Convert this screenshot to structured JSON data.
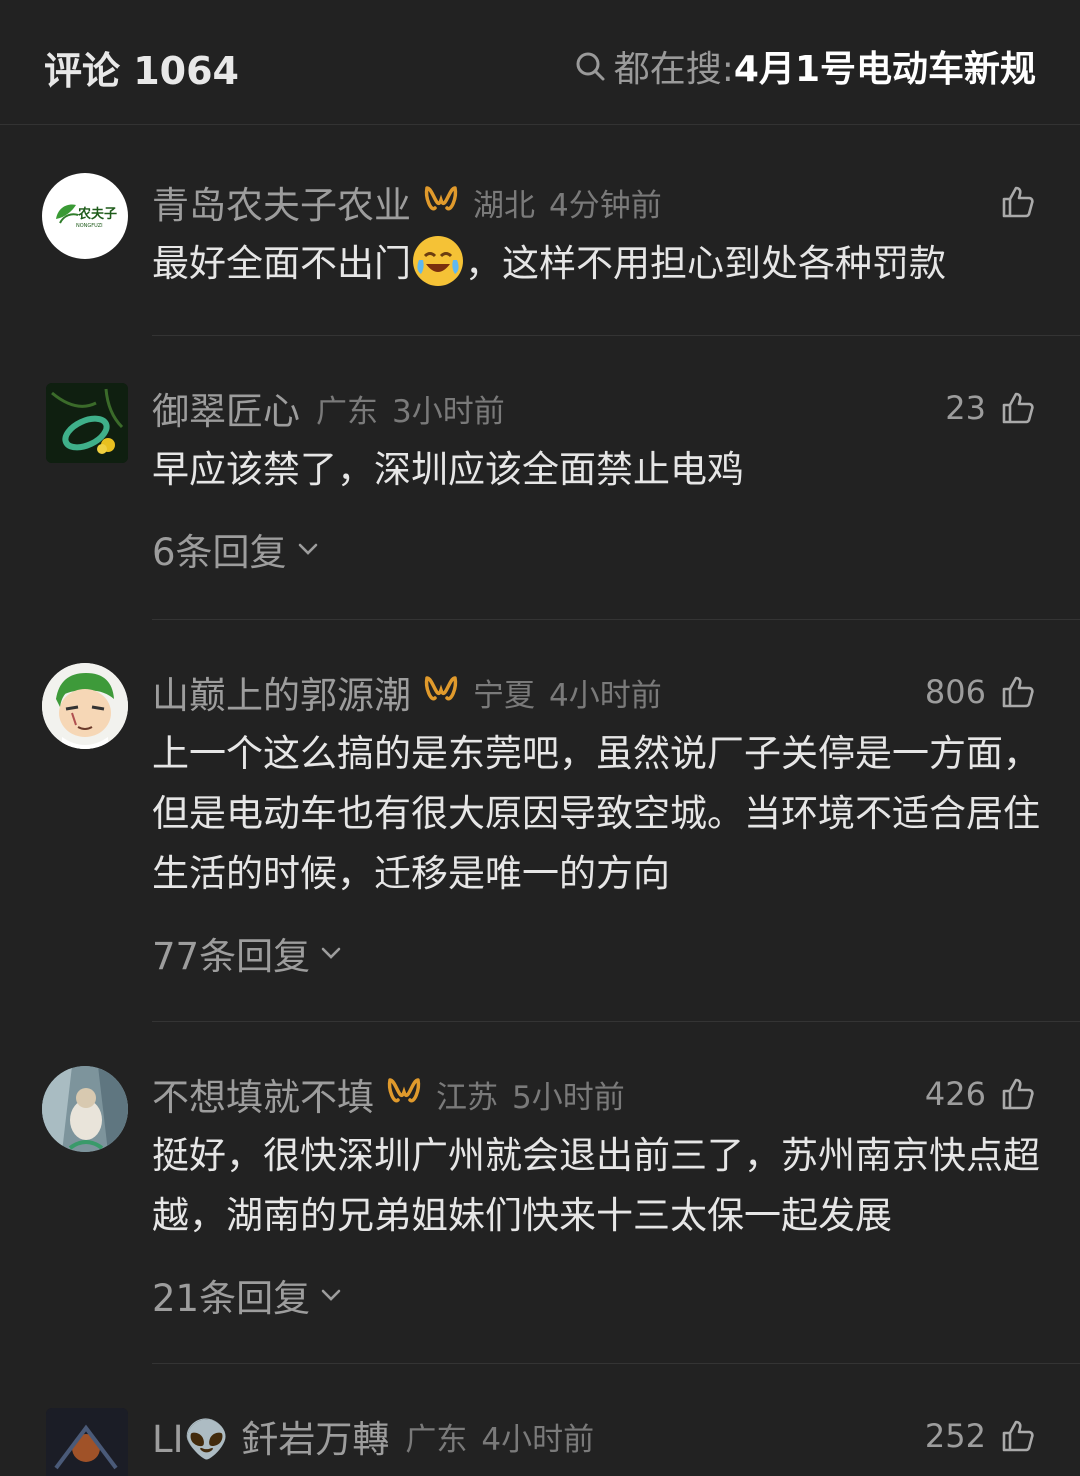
{
  "header": {
    "title": "评论 1064",
    "search_prefix": "都在搜: ",
    "search_query": "4月1号电动车新规"
  },
  "comments": [
    {
      "name": "青岛农夫子农业",
      "has_badge": true,
      "location": "湖北",
      "time": "4分钟前",
      "likes": "",
      "text_before_emoji": "最好全面不出门",
      "emoji": "crying-laughing-emoji",
      "text_after_emoji": "，这样不用担心到处各种罚款",
      "avatar_text": "农夫子",
      "avatar_subtext": "NONGFUZI"
    },
    {
      "name": "御翠匠心",
      "has_badge": false,
      "location": "广东",
      "time": "3小时前",
      "likes": "23",
      "text": "早应该禁了，深圳应该全面禁止电鸡",
      "replies": "6条回复"
    },
    {
      "name": "山巅上的郭源潮",
      "has_badge": true,
      "location": "宁夏",
      "time": "4小时前",
      "likes": "806",
      "text": "上一个这么搞的是东莞吧，虽然说厂子关停是一方面，但是电动车也有很大原因导致空城。当环境不适合居住生活的时候，迁移是唯一的方向",
      "replies": "77条回复"
    },
    {
      "name": "不想填就不填",
      "has_badge": true,
      "location": "江苏",
      "time": "5小时前",
      "likes": "426",
      "text": "挺好，很快深圳广州就会退出前三了，苏州南京快点超越，湖南的兄弟姐妹们快来十三太保一起发展",
      "replies": "21条回复"
    },
    {
      "name": "LI👽 釺岩万轉",
      "has_badge": false,
      "location": "广东",
      "time": "4小时前",
      "likes": "252"
    }
  ],
  "colors": {
    "background": "#222222",
    "text_primary": "#e6e6e6",
    "text_secondary": "#9d9d9d",
    "badge_orange": "#e09a2c"
  }
}
